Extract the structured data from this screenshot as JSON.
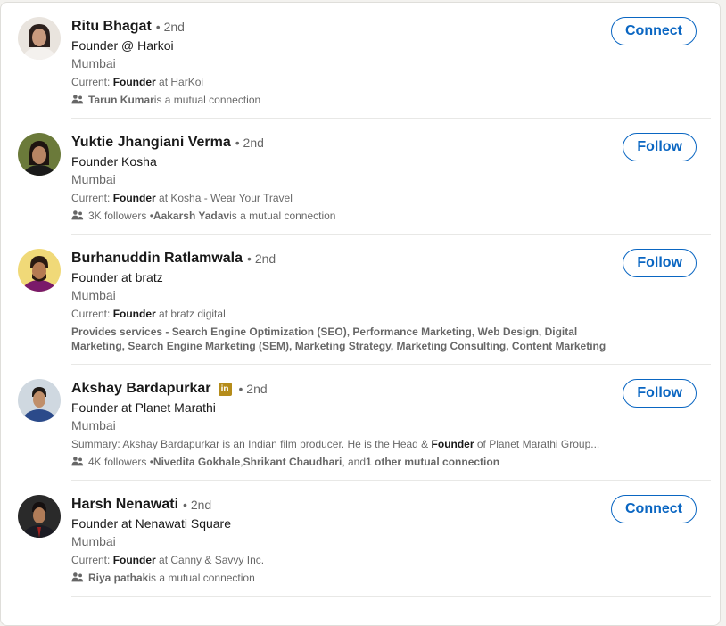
{
  "results": [
    {
      "name": "Ritu Bhagat",
      "degree": "• 2nd",
      "headline": "Founder @ Harkoi",
      "location": "Mumbai",
      "current_prefix": "Current: ",
      "current_title": "Founder",
      "current_suffix": " at HarKoi",
      "insight_text": " is a mutual connection",
      "insight_bold": "Tarun Kumar",
      "action": "Connect"
    },
    {
      "name": "Yuktie Jhangiani Verma",
      "degree": "• 2nd",
      "headline": "Founder Kosha",
      "location": "Mumbai",
      "current_prefix": "Current: ",
      "current_title": "Founder",
      "current_suffix": " at Kosha - Wear Your Travel",
      "followers": "3K followers • ",
      "insight_bold": "Aakarsh Yadav",
      "insight_text": " is a mutual connection",
      "action": "Follow"
    },
    {
      "name": "Burhanuddin Ratlamwala",
      "degree": "• 2nd",
      "headline": "Founder at bratz",
      "location": "Mumbai",
      "current_prefix": "Current: ",
      "current_title": "Founder",
      "current_suffix": " at bratz digital",
      "services": "Provides services - Search Engine Optimization (SEO), Performance Marketing, Web Design, Digital Marketing, Search Engine Marketing (SEM), Marketing Strategy, Marketing Consulting, Content Marketing",
      "action": "Follow"
    },
    {
      "name": "Akshay Bardapurkar",
      "badge": "in",
      "degree": "• 2nd",
      "headline": "Founder at Planet Marathi",
      "location": "Mumbai",
      "summary_prefix": "Summary: Akshay Bardapurkar is an Indian film producer. He is the Head & ",
      "summary_bold": "Founder",
      "summary_suffix": " of Planet Marathi Group...",
      "followers": "4K followers • ",
      "insight_bold": "Nivedita Gokhale",
      "insight_sep": ", ",
      "insight_bold2": "Shrikant Chaudhari",
      "insight_text": ", and ",
      "insight_bold3": "1 other mutual connection",
      "action": "Follow"
    },
    {
      "name": "Harsh Nenawati",
      "degree": "• 2nd",
      "headline": "Founder at Nenawati Square",
      "location": "Mumbai",
      "current_prefix": "Current: ",
      "current_title": "Founder",
      "current_suffix": " at Canny & Savvy Inc.",
      "insight_bold": "Riya pathak",
      "insight_text": " is a mutual connection",
      "action": "Connect"
    }
  ],
  "colors": {
    "accent": "#0a66c2",
    "badge": "#b58c1a"
  }
}
